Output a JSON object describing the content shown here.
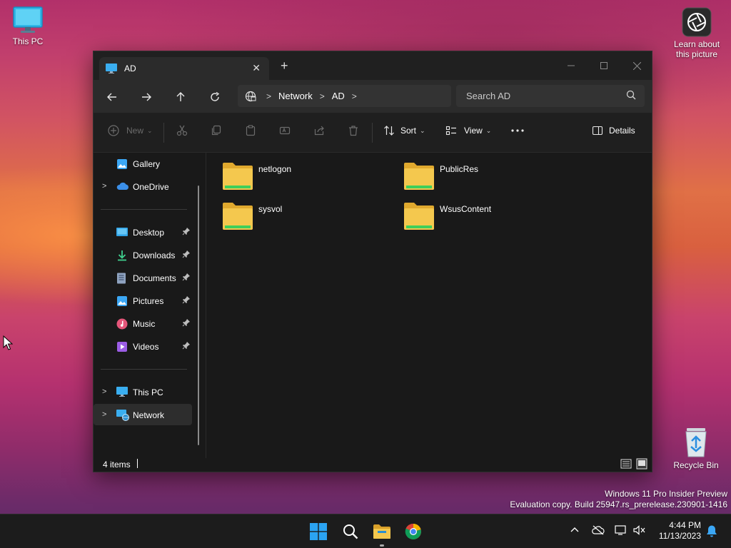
{
  "desktop": {
    "this_pc_label": "This PC",
    "learn_label_1": "Learn about",
    "learn_label_2": "this picture",
    "recycle_label": "Recycle Bin"
  },
  "window": {
    "tab_title": "AD",
    "address": {
      "crumb_1": "Network",
      "crumb_2": "AD"
    },
    "search_placeholder": "Search AD",
    "toolbar": {
      "new_label": "New",
      "sort_label": "Sort",
      "view_label": "View",
      "details_label": "Details"
    },
    "sidebar": {
      "gallery": "Gallery",
      "onedrive": "OneDrive",
      "desktop": "Desktop",
      "downloads": "Downloads",
      "documents": "Documents",
      "pictures": "Pictures",
      "music": "Music",
      "videos": "Videos",
      "thispc": "This PC",
      "network": "Network"
    },
    "folders": [
      "netlogon",
      "PublicRes",
      "sysvol",
      "WsusContent"
    ],
    "status_count": "4 items"
  },
  "watermark": {
    "line_1": "Windows 11 Pro Insider Preview",
    "line_2": "Evaluation copy. Build 25947.rs_prerelease.230901-1416"
  },
  "taskbar": {
    "time": "4:44 PM",
    "date": "11/13/2023"
  },
  "icons": {
    "tab": "monitor-icon",
    "close": "close-icon",
    "new_tab": "plus-icon",
    "back": "back-arrow-icon",
    "forward": "forward-arrow-icon",
    "up": "up-arrow-icon",
    "refresh": "refresh-icon",
    "network": "network-globe-icon",
    "search": "search-icon"
  },
  "colors": {
    "folder_yellow": "#f4c84e",
    "folder_green": "#3fcf5a",
    "accent_blue": "#3ba7f5",
    "window_bg": "#191919"
  }
}
